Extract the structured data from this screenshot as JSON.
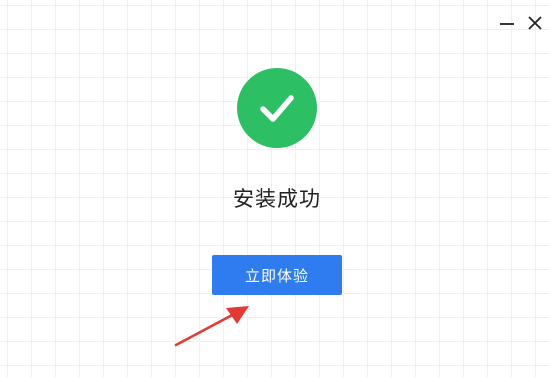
{
  "window": {
    "controls": {
      "minimize_icon": "minimize-icon",
      "close_icon": "close-icon"
    }
  },
  "content": {
    "status_icon": "checkmark-icon",
    "title": "安装成功",
    "primary_button_label": "立即体验"
  },
  "annotation": {
    "arrow_icon": "red-arrow-icon",
    "arrow_color": "#e53935"
  },
  "colors": {
    "success": "#2dbf63",
    "primary": "#2f7cf0"
  }
}
